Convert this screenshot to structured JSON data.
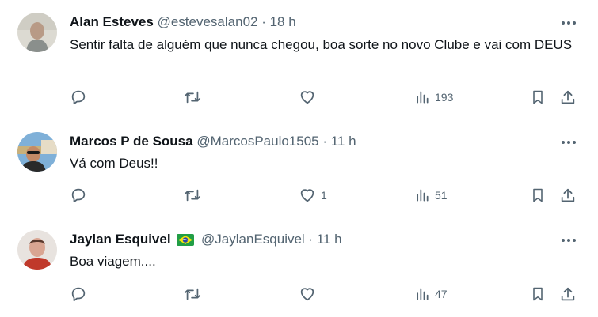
{
  "tweets": [
    {
      "name": "Alan Esteves",
      "meta": "@estevesalan02 · 18 h",
      "text": "Sentir falta de alguém que nunca chegou, boa sorte no novo Clube e vai com DEUS",
      "likes": "",
      "views": "193"
    },
    {
      "name": "Marcos P de Sousa",
      "meta": "@MarcosPaulo1505 · 11 h",
      "text": "Vá com Deus!!",
      "likes": "1",
      "views": "51"
    },
    {
      "name": "Jaylan Esquivel",
      "meta": "@JaylanEsquivel · 11 h",
      "text": "Boa viagem....",
      "likes": "",
      "views": "47"
    }
  ],
  "icons": {
    "more": "more-icon",
    "reply": "reply-icon",
    "retweet": "retweet-icon",
    "like": "heart-icon",
    "views": "views-icon",
    "bookmark": "bookmark-icon",
    "share": "share-icon",
    "flag": "brazil-flag-icon"
  },
  "colors": {
    "text": "#0f1419",
    "secondary": "#536471",
    "divider": "#eff3f4"
  }
}
